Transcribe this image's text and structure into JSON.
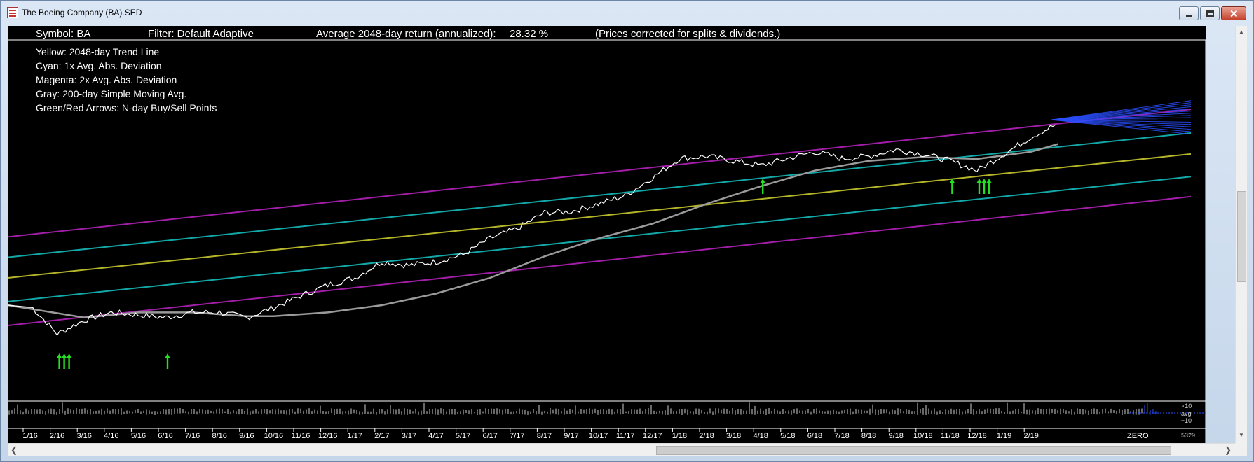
{
  "window": {
    "title": "The Boeing Company (BA).SED"
  },
  "header": {
    "symbol": "Symbol: BA",
    "filter": "Filter: Default Adaptive",
    "avg_return_label": "Average 2048-day return (annualized):",
    "avg_return_value": "28.32 %",
    "note": "(Prices corrected for splits & dividends.)"
  },
  "legend": [
    "Yellow: 2048-day Trend Line",
    "Cyan:       1x Avg. Abs. Deviation",
    "Magenta: 2x Avg. Abs. Deviation",
    "Gray: 200-day Simple Moving Avg.",
    "Green/Red Arrows: N-day Buy/Sell Points"
  ],
  "volume_labels": {
    "top": "×10",
    "mid": "avg",
    "bottom": "÷10",
    "count": "5329"
  },
  "zero_label": "ZERO",
  "colors": {
    "background": "#000000",
    "price": "#ffffff",
    "trend": "#b5b52a",
    "cyan": "#13a7a7",
    "magenta": "#a21ea8",
    "sma": "#9a9a9a",
    "buy_arrow": "#23e023",
    "projection": "#2a4fff"
  },
  "chart_data": {
    "type": "line",
    "y_scale": "log",
    "ylim": [
      70,
      720
    ],
    "y_ticks": [
      80,
      96,
      112,
      128,
      160,
      192,
      224,
      256,
      320,
      384,
      448,
      512,
      640
    ],
    "x_tick_labels": [
      "1/16",
      "2/16",
      "3/16",
      "4/16",
      "5/16",
      "6/16",
      "7/16",
      "8/16",
      "9/16",
      "10/16",
      "11/16",
      "12/16",
      "1/17",
      "2/17",
      "3/17",
      "4/17",
      "5/17",
      "6/17",
      "7/17",
      "8/17",
      "9/17",
      "10/17",
      "11/17",
      "12/17",
      "1/18",
      "2/18",
      "3/18",
      "4/18",
      "5/18",
      "6/18",
      "7/18",
      "8/18",
      "9/18",
      "10/18",
      "11/18",
      "12/18",
      "1/19",
      "2/19"
    ],
    "grid": false,
    "series": [
      {
        "name": "Yellow: 2048-day Trend Line",
        "x_start": "1/16",
        "x_end": "3/19",
        "values": [
          155,
          345
        ]
      },
      {
        "name": "Cyan: 1x Avg. Abs. Deviation (upper)",
        "x_start": "1/16",
        "x_end": "3/19",
        "values": [
          177,
          395
        ]
      },
      {
        "name": "Cyan: 1x Avg. Abs. Deviation (lower)",
        "x_start": "1/16",
        "x_end": "3/19",
        "values": [
          133,
          298
        ]
      },
      {
        "name": "Magenta: 2x Avg. Abs. Deviation (upper)",
        "x_start": "1/16",
        "x_end": "3/19",
        "values": [
          202,
          460
        ]
      },
      {
        "name": "Magenta: 2x Avg. Abs. Deviation (lower)",
        "x_start": "1/16",
        "x_end": "3/19",
        "values": [
          114,
          262
        ]
      },
      {
        "name": "Gray: 200-day Simple Moving Avg.",
        "x": [
          "1/16",
          "3/16",
          "5/16",
          "7/16",
          "9/16",
          "10/16",
          "12/16",
          "2/17",
          "4/17",
          "6/17",
          "8/17",
          "10/17",
          "12/17",
          "2/18",
          "4/18",
          "6/18",
          "8/18",
          "10/18",
          "12/18",
          "2/19",
          "3/19"
        ],
        "values": [
          130,
          120,
          124,
          124,
          121,
          121,
          124,
          130,
          140,
          155,
          178,
          200,
          220,
          250,
          280,
          310,
          330,
          338,
          334,
          350,
          368
        ]
      },
      {
        "name": "Price",
        "x": [
          "1/16",
          "2/16",
          "3/16",
          "4/16",
          "5/16",
          "6/16",
          "7/16",
          "8/16",
          "9/16",
          "10/16",
          "11/16",
          "12/16",
          "1/17",
          "2/17",
          "3/17",
          "4/17",
          "5/17",
          "6/17",
          "7/17",
          "8/17",
          "9/17",
          "10/17",
          "11/17",
          "12/17",
          "1/18",
          "2/18",
          "3/18",
          "4/18",
          "5/18",
          "6/18",
          "7/18",
          "8/18",
          "9/18",
          "10/18",
          "11/18",
          "12/18",
          "1/19",
          "2/19",
          "3/19"
        ],
        "values": [
          130,
          108,
          118,
          124,
          122,
          120,
          124,
          124,
          120,
          128,
          138,
          148,
          155,
          172,
          168,
          172,
          180,
          200,
          213,
          236,
          238,
          250,
          264,
          296,
          335,
          340,
          330,
          320,
          335,
          350,
          335,
          340,
          355,
          345,
          330,
          310,
          345,
          385,
          420
        ]
      }
    ],
    "buy_points": [
      "2/16",
      "2/16",
      "2/16",
      "6/16",
      "4/18",
      "11/18",
      "12/18",
      "12/18",
      "12/18"
    ]
  }
}
